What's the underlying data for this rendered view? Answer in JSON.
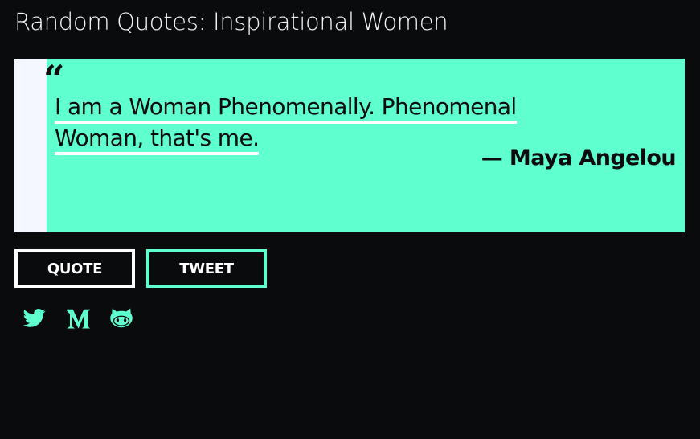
{
  "header": {
    "title": "Random Quotes: Inspirational Women"
  },
  "quote": {
    "open_mark": "“",
    "line1": " I am a Woman Phenomenally. Phenomenal",
    "line2": "Woman, that's me.",
    "author": "— Maya Angelou"
  },
  "buttons": {
    "quote_label": "QUOTE",
    "tweet_label": "TWEET"
  },
  "social": [
    {
      "name": "twitter",
      "icon": "twitter-icon"
    },
    {
      "name": "medium",
      "icon": "medium-icon"
    },
    {
      "name": "github",
      "icon": "github-icon"
    }
  ],
  "colors": {
    "background": "#0a0b0d",
    "accent": "#5fffd0",
    "stripe": "#f4f7ff",
    "text_dark": "#0a0b0d",
    "text_light": "#ffffff"
  }
}
